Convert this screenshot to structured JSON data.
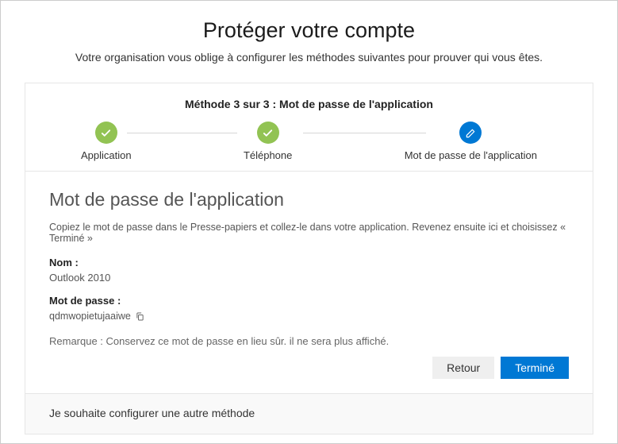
{
  "header": {
    "title": "Protéger votre compte",
    "subtitle": "Votre organisation vous oblige à configurer les méthodes suivantes pour prouver qui vous êtes."
  },
  "stepper": {
    "title": "Méthode 3 sur 3 : Mot de passe de l'application",
    "steps": [
      {
        "label": "Application",
        "state": "done"
      },
      {
        "label": "Téléphone",
        "state": "done"
      },
      {
        "label": "Mot de passe de l'application",
        "state": "current"
      }
    ]
  },
  "content": {
    "heading": "Mot de passe de l'application",
    "description": "Copiez le mot de passe dans le Presse-papiers et collez-le dans votre application. Revenez ensuite ici et choisissez « Terminé »",
    "name_label": "Nom :",
    "name_value": "Outlook 2010",
    "password_label": "Mot de passe :",
    "password_value": "qdmwopietujaaiwe",
    "note": "Remarque : Conservez ce mot de passe en lieu sûr. il ne sera plus affiché."
  },
  "actions": {
    "back": "Retour",
    "done": "Terminé"
  },
  "footer": {
    "other_method": "Je souhaite configurer une autre méthode"
  }
}
